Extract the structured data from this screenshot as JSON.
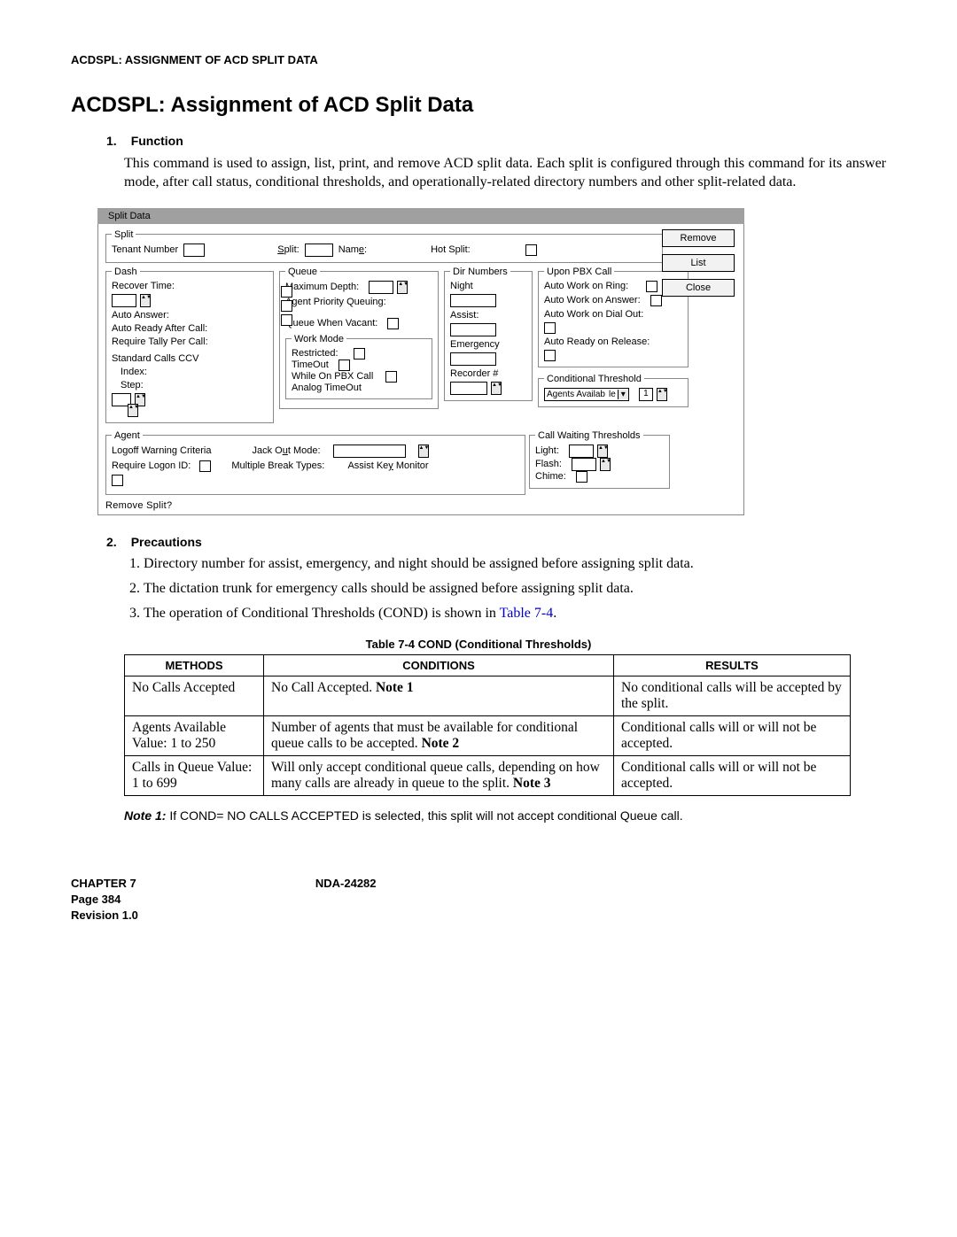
{
  "header": "ACDSPL: ASSIGNMENT OF ACD SPLIT DATA",
  "title": "ACDSPL: Assignment of ACD Split Data",
  "section1": {
    "num": "1.",
    "label": "Function",
    "text": "This command is used to assign, list, print, and remove ACD split data. Each split is configured through this command for its answer mode, after call status, conditional thresholds, and operationally-related directory numbers and other split-related data."
  },
  "gui": {
    "title": "Split Data",
    "split": {
      "legend": "Split",
      "tenant": "Tenant Number",
      "split_underline": "Split:",
      "name_underline": "Name:",
      "hot": "Hot Split:"
    },
    "buttons": {
      "remove": "Remove",
      "list": "List",
      "close": "Close"
    },
    "dash": {
      "legend": "Dash",
      "recover": "Recover Time:",
      "auto_answer": "Auto Answer:",
      "auto_ready": "Auto Ready After Call:",
      "tally": "Require Tally Per Call:",
      "ccv": "Standard Calls CCV",
      "index": "Index:",
      "step": "Step:"
    },
    "queue": {
      "legend": "Queue",
      "max": "Maximum Depth:",
      "apq": "Agent Priority Queuing:",
      "qwv": "Queue When Vacant:",
      "workmode": "Work Mode",
      "restricted": "Restricted:",
      "timeout": "TimeOut",
      "while_pbx": "While On PBX Call",
      "analog": "Analog TimeOut"
    },
    "dir": {
      "legend": "Dir Numbers",
      "night": "Night",
      "assist": "Assist:",
      "emergency": "Emergency",
      "recorder": "Recorder #"
    },
    "upon": {
      "legend": "Upon PBX Call",
      "awr": "Auto Work on Ring:",
      "awa": "Auto Work on Answer:",
      "awd": "Auto Work on Dial Out:",
      "aror": "Auto Ready on Release:"
    },
    "cond": {
      "legend": "Conditional Threshold",
      "avail_l": "Agents Availab",
      "avail_r": "le",
      "one": "1"
    },
    "agent": {
      "legend": "Agent",
      "logoff": "Logoff Warning Criteria",
      "jack": "Jack Out Mode:",
      "require": "Require Logon ID:",
      "mbt": "Multiple Break Types:",
      "akm": "Assist Key Monitor"
    },
    "cwt": {
      "legend": "Call Waiting Thresholds",
      "light": "Light:",
      "flash": "Flash:",
      "chime": "Chime:"
    },
    "remove_split": "Remove Split?"
  },
  "section2": {
    "num": "2.",
    "label": "Precautions"
  },
  "precautions": [
    "Directory number for assist, emergency, and night should be assigned before assigning split data.",
    "The dictation trunk for emergency calls should be assigned before assigning split data."
  ],
  "precaution3_a": "The operation of Conditional Thresholds (COND) is shown in ",
  "precaution3_link": "Table 7-4",
  "precaution3_b": ".",
  "table_caption": "Table 7-4  COND (Conditional Thresholds)",
  "table": {
    "h1": "METHODS",
    "h2": "CONDITIONS",
    "h3": "RESULTS",
    "r1c1": "No Calls Accepted",
    "r1c2a": "No Call Accepted. ",
    "r1c2b": "Note 1",
    "r1c3": "No conditional calls will be accepted by the split.",
    "r2c1": "Agents Available Value: 1 to 250",
    "r2c2a": "Number of agents that must be available for conditional queue calls to be accepted. ",
    "r2c2b": "Note 2",
    "r2c3": "Conditional calls will or will not be accepted.",
    "r3c1": "Calls in Queue Value: 1 to 699",
    "r3c2a": "Will only accept conditional queue calls, depending on how many calls are already in queue to the split. ",
    "r3c2b": "Note 3",
    "r3c3": "Conditional calls will or will not be accepted."
  },
  "note1": {
    "label": "Note 1:",
    "text": "  If COND= NO CALLS ACCEPTED is selected, this split will not accept conditional Queue call."
  },
  "footer": {
    "chapter": "CHAPTER 7",
    "nda": "NDA-24282",
    "page": "Page 384",
    "rev": "Revision 1.0"
  }
}
